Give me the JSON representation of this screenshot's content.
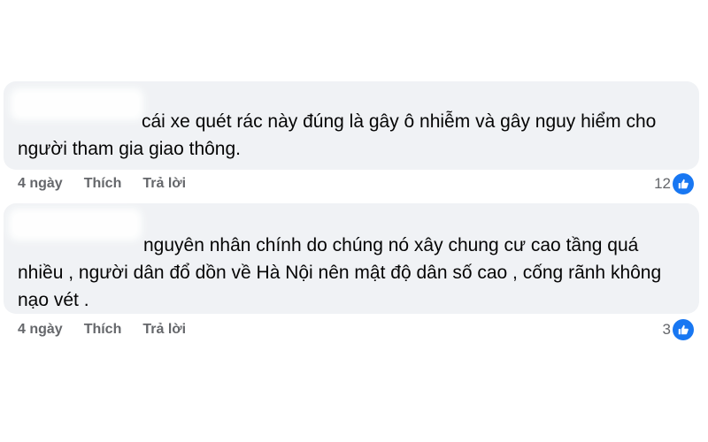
{
  "comments": [
    {
      "text": "cái xe quét rác này đúng là gây ô nhiễm và gây nguy hiểm cho\nngười tham gia giao thông.",
      "time": "4 ngày",
      "like_label": "Thích",
      "reply_label": "Trả lời",
      "reaction_count": "12",
      "reaction_icon": "like-icon"
    },
    {
      "text": "nguyên nhân chính do chúng nó xây chung cư cao tầng quá\nnhiều , người dân đổ dồn về Hà Nội nên mật độ dân số cao , cống rãnh không\nnạo vét .",
      "time": "4 ngày",
      "like_label": "Thích",
      "reply_label": "Trả lời",
      "reaction_count": "3",
      "reaction_icon": "like-icon"
    }
  ],
  "colors": {
    "bubble": "#f0f2f5",
    "text": "#050505",
    "meta": "#65676b",
    "like_blue": "#1877f2"
  }
}
